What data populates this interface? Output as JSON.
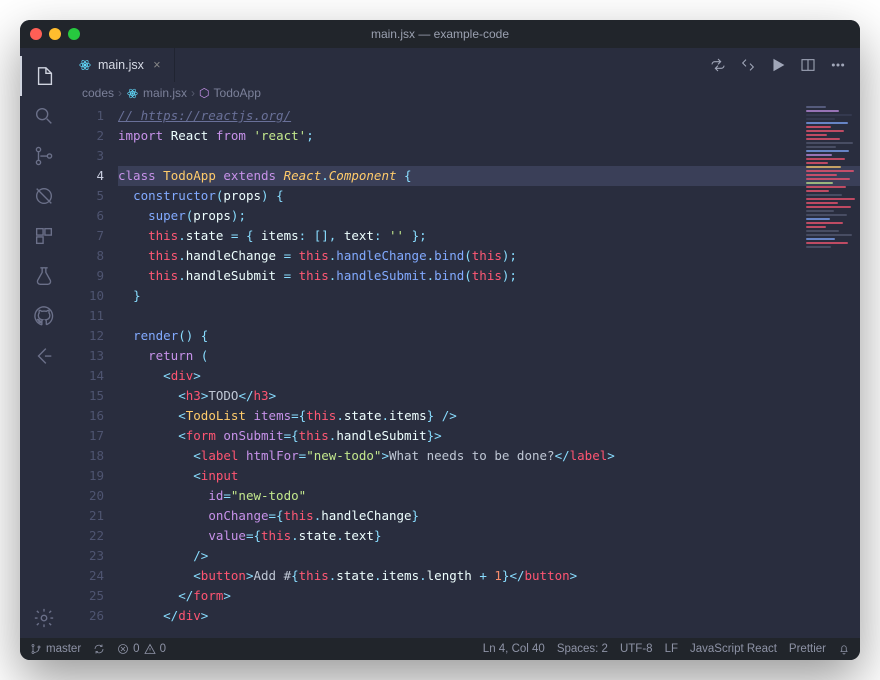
{
  "window": {
    "title": "main.jsx — example-code"
  },
  "tab": {
    "filename": "main.jsx"
  },
  "breadcrumbs": {
    "seg1": "codes",
    "seg2": "main.jsx",
    "seg3": "TodoApp"
  },
  "tab_actions": [
    "go-to-changes",
    "toggle-word-wrap",
    "run",
    "split-editor",
    "more"
  ],
  "status": {
    "branch": "master",
    "errors": "0",
    "warnings": "0",
    "position": "Ln 4, Col 40",
    "spaces": "Spaces: 2",
    "encoding": "UTF-8",
    "eol": "LF",
    "language": "JavaScript React",
    "formatter": "Prettier"
  },
  "code": {
    "lines": [
      {
        "n": 1,
        "html": "<span class='c-comment'>// https://reactjs.org/</span>"
      },
      {
        "n": 2,
        "html": "<span class='c-kw'>import</span> <span class='c-id'>React</span> <span class='c-kw'>from</span> <span class='c-str'>'react'</span><span class='c-punc'>;</span>"
      },
      {
        "n": 3,
        "html": ""
      },
      {
        "n": 4,
        "hl": true,
        "html": "<span class='c-kw'>class</span> <span class='c-cls'>TodoApp</span> <span class='c-kw'>extends</span> <span class='c-cls' style='font-style:italic'>React</span><span class='c-punc'>.</span><span class='c-cls' style='font-style:italic'>Component</span> <span class='c-punc'>{</span>"
      },
      {
        "n": 5,
        "html": "  <span class='c-fn'>constructor</span><span class='c-punc'>(</span><span class='c-id'>props</span><span class='c-punc'>) {</span>"
      },
      {
        "n": 6,
        "html": "    <span class='c-fn'>super</span><span class='c-punc'>(</span><span class='c-id'>props</span><span class='c-punc'>);</span>"
      },
      {
        "n": 7,
        "html": "    <span class='c-this'>this</span><span class='c-punc'>.</span><span class='c-id'>state</span> <span class='c-punc'>= {</span> <span class='c-id'>items</span><span class='c-punc'>:</span> <span class='c-punc'>[],</span> <span class='c-id'>text</span><span class='c-punc'>:</span> <span class='c-str'>''</span> <span class='c-punc'>};</span>"
      },
      {
        "n": 8,
        "html": "    <span class='c-this'>this</span><span class='c-punc'>.</span><span class='c-id'>handleChange</span> <span class='c-punc'>=</span> <span class='c-this'>this</span><span class='c-punc'>.</span><span class='c-fn'>handleChange</span><span class='c-punc'>.</span><span class='c-fn'>bind</span><span class='c-punc'>(</span><span class='c-this'>this</span><span class='c-punc'>);</span>"
      },
      {
        "n": 9,
        "html": "    <span class='c-this'>this</span><span class='c-punc'>.</span><span class='c-id'>handleSubmit</span> <span class='c-punc'>=</span> <span class='c-this'>this</span><span class='c-punc'>.</span><span class='c-fn'>handleSubmit</span><span class='c-punc'>.</span><span class='c-fn'>bind</span><span class='c-punc'>(</span><span class='c-this'>this</span><span class='c-punc'>);</span>"
      },
      {
        "n": 10,
        "html": "  <span class='c-punc'>}</span>"
      },
      {
        "n": 11,
        "html": ""
      },
      {
        "n": 12,
        "html": "  <span class='c-fn'>render</span><span class='c-punc'>() {</span>"
      },
      {
        "n": 13,
        "html": "    <span class='c-kw'>return</span> <span class='c-punc'>(</span>"
      },
      {
        "n": 14,
        "html": "      <span class='c-punc'>&lt;</span><span class='c-tag'>div</span><span class='c-punc'>&gt;</span>"
      },
      {
        "n": 15,
        "html": "        <span class='c-punc'>&lt;</span><span class='c-tag'>h3</span><span class='c-punc'>&gt;</span><span class='c-jsx'>TODO</span><span class='c-punc'>&lt;/</span><span class='c-tag'>h3</span><span class='c-punc'>&gt;</span>"
      },
      {
        "n": 16,
        "html": "        <span class='c-punc'>&lt;</span><span class='c-cls'>TodoList</span> <span class='c-attr'>items</span><span class='c-punc'>={</span><span class='c-this'>this</span><span class='c-punc'>.</span><span class='c-id'>state</span><span class='c-punc'>.</span><span class='c-id'>items</span><span class='c-punc'>} /&gt;</span>"
      },
      {
        "n": 17,
        "html": "        <span class='c-punc'>&lt;</span><span class='c-tag'>form</span> <span class='c-attr'>onSubmit</span><span class='c-punc'>={</span><span class='c-this'>this</span><span class='c-punc'>.</span><span class='c-id'>handleSubmit</span><span class='c-punc'>}&gt;</span>"
      },
      {
        "n": 18,
        "html": "          <span class='c-punc'>&lt;</span><span class='c-tag'>label</span> <span class='c-attr'>htmlFor</span><span class='c-punc'>=</span><span class='c-str'>\"new-todo\"</span><span class='c-punc'>&gt;</span><span class='c-jsx'>What needs to be done?</span><span class='c-punc'>&lt;/</span><span class='c-tag'>label</span><span class='c-punc'>&gt;</span>"
      },
      {
        "n": 19,
        "html": "          <span class='c-punc'>&lt;</span><span class='c-tag'>input</span>"
      },
      {
        "n": 20,
        "html": "            <span class='c-attr'>id</span><span class='c-punc'>=</span><span class='c-str'>\"new-todo\"</span>"
      },
      {
        "n": 21,
        "html": "            <span class='c-attr'>onChange</span><span class='c-punc'>={</span><span class='c-this'>this</span><span class='c-punc'>.</span><span class='c-id'>handleChange</span><span class='c-punc'>}</span>"
      },
      {
        "n": 22,
        "html": "            <span class='c-attr'>value</span><span class='c-punc'>={</span><span class='c-this'>this</span><span class='c-punc'>.</span><span class='c-id'>state</span><span class='c-punc'>.</span><span class='c-id'>text</span><span class='c-punc'>}</span>"
      },
      {
        "n": 23,
        "html": "          <span class='c-punc'>/&gt;</span>"
      },
      {
        "n": 24,
        "html": "          <span class='c-punc'>&lt;</span><span class='c-tag'>button</span><span class='c-punc'>&gt;</span><span class='c-jsx'>Add #</span><span class='c-punc'>{</span><span class='c-this'>this</span><span class='c-punc'>.</span><span class='c-id'>state</span><span class='c-punc'>.</span><span class='c-id'>items</span><span class='c-punc'>.</span><span class='c-id'>length</span> <span class='c-punc'>+</span> <span class='c-prop'>1</span><span class='c-punc'>}&lt;/</span><span class='c-tag'>button</span><span class='c-punc'>&gt;</span>"
      },
      {
        "n": 25,
        "html": "        <span class='c-punc'>&lt;/</span><span class='c-tag'>form</span><span class='c-punc'>&gt;</span>"
      },
      {
        "n": 26,
        "html": "      <span class='c-punc'>&lt;/</span><span class='c-tag'>div</span><span class='c-punc'>&gt;</span>"
      }
    ]
  },
  "minimap_colors": [
    "#697098",
    "#c792ea",
    "#3a3f58",
    "#3a3f58",
    "#82aaff",
    "#ff5874",
    "#ff5874",
    "#ff5874",
    "#ff5874",
    "#565b73",
    "#565b73",
    "#82aaff",
    "#c792ea",
    "#ff5572",
    "#ff5572",
    "#ffcb6b",
    "#ff5572",
    "#ff5572",
    "#ff5572",
    "#c3e88d",
    "#ff5874",
    "#ff5874",
    "#565b73",
    "#ff5572",
    "#ff5572",
    "#ff5572",
    "#565b73",
    "#565b73",
    "#82aaff",
    "#ff5874",
    "#ff5874",
    "#565b73",
    "#565b73",
    "#82aaff",
    "#ff5874",
    "#565b73"
  ]
}
